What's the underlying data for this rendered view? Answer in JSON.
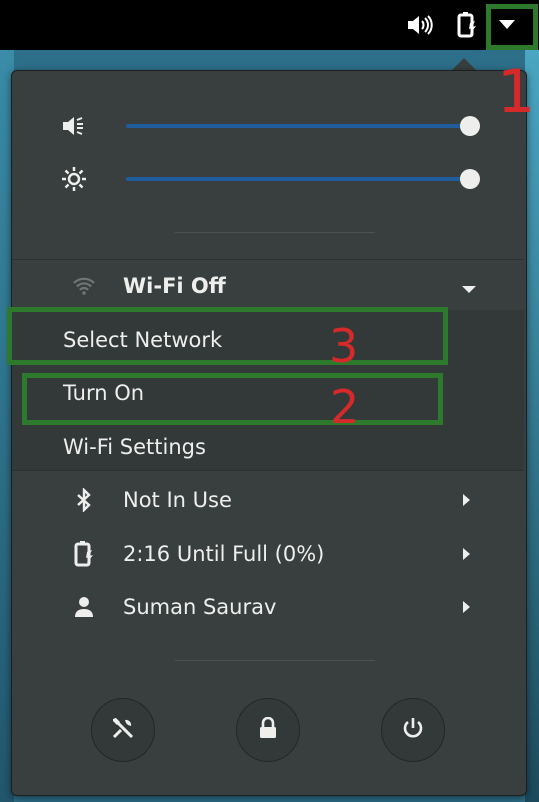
{
  "topbar": {
    "icons": [
      "volume-icon",
      "battery-icon",
      "menu-arrow-icon"
    ]
  },
  "menu": {
    "volume_slider": {
      "icon": "speaker-icon",
      "level": 1.0
    },
    "brightness_slider": {
      "icon": "brightness-icon",
      "level": 1.0
    },
    "wifi": {
      "label": "Wi-Fi Off",
      "icon": "wifi-icon",
      "submenu": [
        "Select Network",
        "Turn On",
        "Wi-Fi Settings"
      ]
    },
    "bluetooth": {
      "label": "Not In Use",
      "icon": "bluetooth-icon"
    },
    "power": {
      "label": "2:16 Until Full (0%)",
      "icon": "battery-icon"
    },
    "user": {
      "label": "Suman Saurav",
      "icon": "user-icon"
    },
    "buttons": [
      "settings-icon",
      "lock-icon",
      "power-icon"
    ]
  },
  "annotations": {
    "one": "1",
    "two": "2",
    "three": "3"
  },
  "colors": {
    "accent": "#215d9c",
    "annotation_box": "#2d7a2d",
    "annotation_number": "#d62a2a"
  }
}
